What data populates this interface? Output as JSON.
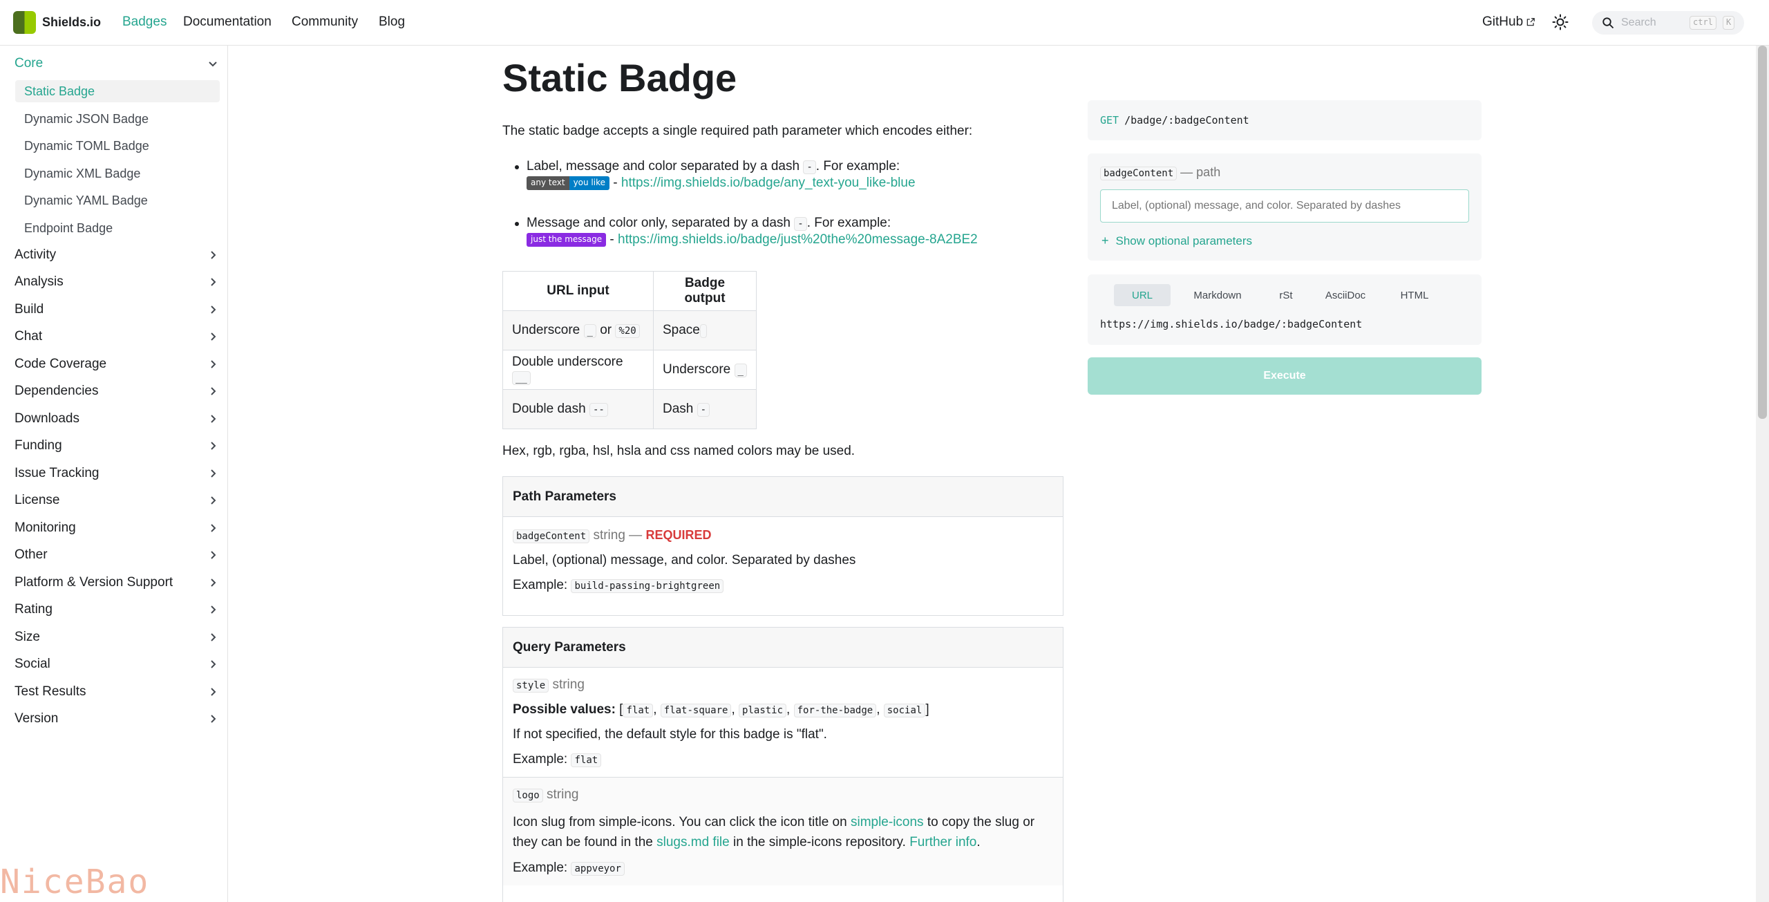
{
  "navbar": {
    "brand": "Shields.io",
    "links": [
      "Badges",
      "Documentation",
      "Community",
      "Blog"
    ],
    "github": "GitHub",
    "search_placeholder": "Search",
    "kbd_ctrl": "ctrl",
    "kbd_k": "K"
  },
  "sidebar": {
    "core_label": "Core",
    "core_items": [
      "Static Badge",
      "Dynamic JSON Badge",
      "Dynamic TOML Badge",
      "Dynamic XML Badge",
      "Dynamic YAML Badge",
      "Endpoint Badge"
    ],
    "categories": [
      "Activity",
      "Analysis",
      "Build",
      "Chat",
      "Code Coverage",
      "Dependencies",
      "Downloads",
      "Funding",
      "Issue Tracking",
      "License",
      "Monitoring",
      "Other",
      "Platform & Version Support",
      "Rating",
      "Size",
      "Social",
      "Test Results",
      "Version"
    ]
  },
  "watermark": "NiceBao",
  "main": {
    "title": "Static Badge",
    "intro": "The static badge accepts a single required path parameter which encodes either:",
    "bullet1": {
      "text_a": "Label, message and color separated by a dash ",
      "code": "-",
      "text_b": ". For example:",
      "badge_label": "any text",
      "badge_message": "you like",
      "sep": " - ",
      "url": "https://img.shields.io/badge/any_text-you_like-blue"
    },
    "bullet2": {
      "text_a": "Message and color only, separated by a dash ",
      "code": "-",
      "text_b": ". For example:",
      "badge_message": "just the message",
      "sep": " - ",
      "url": "https://img.shields.io/badge/just%20the%20message-8A2BE2"
    },
    "table": {
      "headers": [
        "URL input",
        "Badge output"
      ],
      "rows": [
        {
          "in_text": "Underscore ",
          "in_code1": "_",
          "in_mid": " or ",
          "in_code2": "%20",
          "out_text": "Space ",
          "out_code": " "
        },
        {
          "in_text": "Double underscore ",
          "in_code1": "__",
          "out_text": "Underscore ",
          "out_code": "_"
        },
        {
          "in_text": "Double dash ",
          "in_code1": "--",
          "out_text": "Dash ",
          "out_code": "-"
        }
      ]
    },
    "colors_note": "Hex, rgb, rgba, hsl, hsla and css named colors may be used.",
    "path_params": {
      "heading": "Path Parameters",
      "name": "badgeContent",
      "type": "string —",
      "required": "REQUIRED",
      "desc": "Label, (optional) message, and color. Separated by dashes",
      "example_label": "Example:",
      "example": "build-passing-brightgreen"
    },
    "query_params": {
      "heading": "Query Parameters",
      "style": {
        "name": "style",
        "type": "string",
        "possible_label": "Possible values:",
        "values": [
          "flat",
          "flat-square",
          "plastic",
          "for-the-badge",
          "social"
        ],
        "default_note": "If not specified, the default style for this badge is \"flat\".",
        "example_label": "Example:",
        "example": "flat"
      },
      "logo": {
        "name": "logo",
        "type": "string",
        "desc_a": "Icon slug from simple-icons. You can click the icon title on ",
        "link1": "simple-icons",
        "desc_b": " to copy the slug or",
        "desc_c": "they can be found in the ",
        "link2": "slugs.md file",
        "desc_d": " in the simple-icons repository. ",
        "link3": "Further info",
        "desc_e": ".",
        "example_label": "Example:",
        "example": "appveyor"
      }
    }
  },
  "right": {
    "method": "GET",
    "endpoint": "/badge/:badgeContent",
    "param_name": "badgeContent",
    "param_kind": "— path",
    "input_placeholder": "Label, (optional) message, and color. Separated by dashes",
    "show_optional": "Show optional parameters",
    "tabs": [
      "URL",
      "Markdown",
      "rSt",
      "AsciiDoc",
      "HTML"
    ],
    "generated_url": "https://img.shields.io/badge/:badgeContent",
    "execute": "Execute"
  },
  "colors": {
    "accent": "#25a58f",
    "badge_gray": "#555555",
    "badge_blue": "#007ec6",
    "badge_purple": "#8a2be2",
    "required_red": "#d83b3b"
  }
}
